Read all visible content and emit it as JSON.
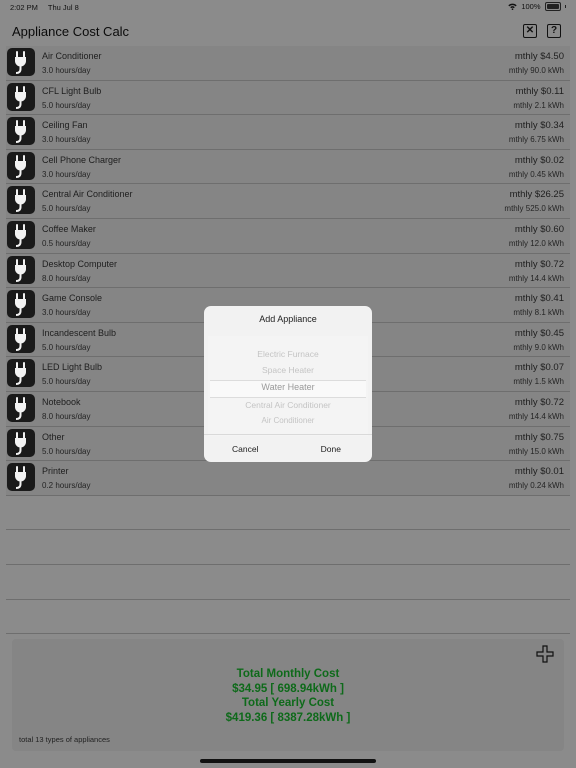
{
  "status_bar": {
    "time": "2:02 PM",
    "date": "Thu Jul 8",
    "battery": "100%"
  },
  "app": {
    "title": "Appliance Cost Calc"
  },
  "appliances": [
    {
      "name": "Air Conditioner",
      "hours": "3.0 hours/day",
      "cost": "mthly $4.50",
      "kwh": "mthly 90.0 kWh"
    },
    {
      "name": "CFL Light Bulb",
      "hours": "5.0 hours/day",
      "cost": "mthly $0.11",
      "kwh": "mthly 2.1 kWh"
    },
    {
      "name": "Ceiling Fan",
      "hours": "3.0 hours/day",
      "cost": "mthly $0.34",
      "kwh": "mthly 6.75 kWh"
    },
    {
      "name": "Cell Phone Charger",
      "hours": "3.0 hours/day",
      "cost": "mthly $0.02",
      "kwh": "mthly 0.45 kWh"
    },
    {
      "name": "Central Air Conditioner",
      "hours": "5.0 hours/day",
      "cost": "mthly $26.25",
      "kwh": "mthly 525.0 kWh"
    },
    {
      "name": "Coffee Maker",
      "hours": "0.5 hours/day",
      "cost": "mthly $0.60",
      "kwh": "mthly 12.0 kWh"
    },
    {
      "name": "Desktop Computer",
      "hours": "8.0 hours/day",
      "cost": "mthly $0.72",
      "kwh": "mthly 14.4 kWh"
    },
    {
      "name": "Game Console",
      "hours": "3.0 hours/day",
      "cost": "mthly $0.41",
      "kwh": "mthly 8.1 kWh"
    },
    {
      "name": "Incandescent Bulb",
      "hours": "5.0 hours/day",
      "cost": "mthly $0.45",
      "kwh": "mthly 9.0 kWh"
    },
    {
      "name": "LED Light Bulb",
      "hours": "5.0 hours/day",
      "cost": "mthly $0.07",
      "kwh": "mthly 1.5 kWh"
    },
    {
      "name": "Notebook",
      "hours": "8.0 hours/day",
      "cost": "mthly $0.72",
      "kwh": "mthly 14.4 kWh"
    },
    {
      "name": "Other",
      "hours": "5.0 hours/day",
      "cost": "mthly $0.75",
      "kwh": "mthly 15.0 kWh"
    },
    {
      "name": "Printer",
      "hours": "0.2 hours/day",
      "cost": "mthly $0.01",
      "kwh": "mthly 0.24 kWh"
    }
  ],
  "footer": {
    "monthly_label": "Total Monthly Cost",
    "monthly_value": "$34.95 [ 698.94kWh ]",
    "yearly_label": "Total Yearly Cost",
    "yearly_value": "$419.36 [ 8387.28kWh ]",
    "count_text": "total 13 types of appliances"
  },
  "dialog": {
    "title": "Add Appliance",
    "picker_items": [
      "Electric Furnace",
      "Space Heater",
      "Water Heater",
      "Central Air Conditioner",
      "Air Conditioner"
    ],
    "selected": "Water Heater",
    "cancel_label": "Cancel",
    "done_label": "Done"
  },
  "colors": {
    "total_text": "#0e6a1a",
    "overlay": "#8b8b8b"
  },
  "icons": {
    "appliance": "plug-icon",
    "close": "close-icon",
    "help": "help-icon",
    "add": "plus-icon"
  }
}
